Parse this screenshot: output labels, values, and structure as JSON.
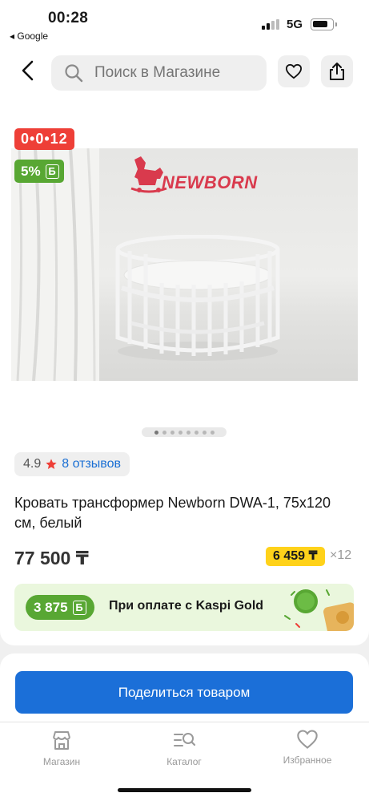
{
  "status_bar": {
    "time": "00:28",
    "back_app": "◂ Google",
    "network": "5G"
  },
  "search": {
    "placeholder": "Поиск в Магазине"
  },
  "badges": {
    "timer": "0•0•12",
    "bonus_percent": "5%",
    "bonus_symbol": "Б"
  },
  "gallery": {
    "logo_text": "NEWBORN",
    "image_count": 8,
    "active_index": 0
  },
  "rating": {
    "value": "4.9",
    "reviews": "8 отзывов"
  },
  "product": {
    "title": "Кровать трансформер Newborn DWA-1, 75x120 см, белый",
    "price": "77 500 ₸",
    "installment": "6 459 ₸",
    "installment_times": "×12"
  },
  "kaspi": {
    "bonus": "3 875",
    "bonus_symbol": "Б",
    "text": "При оплате с Kaspi Gold"
  },
  "actions": {
    "share": "Поделиться товаром"
  },
  "tabs": [
    {
      "label": "Магазин",
      "icon": "store-icon"
    },
    {
      "label": "Каталог",
      "icon": "catalog-icon"
    },
    {
      "label": "Избранное",
      "icon": "heart-icon"
    }
  ],
  "colors": {
    "accent_blue": "#1b6fd8",
    "timer_red": "#ee3f37",
    "bonus_green": "#58a733",
    "installment_yellow": "#ffd21a"
  }
}
